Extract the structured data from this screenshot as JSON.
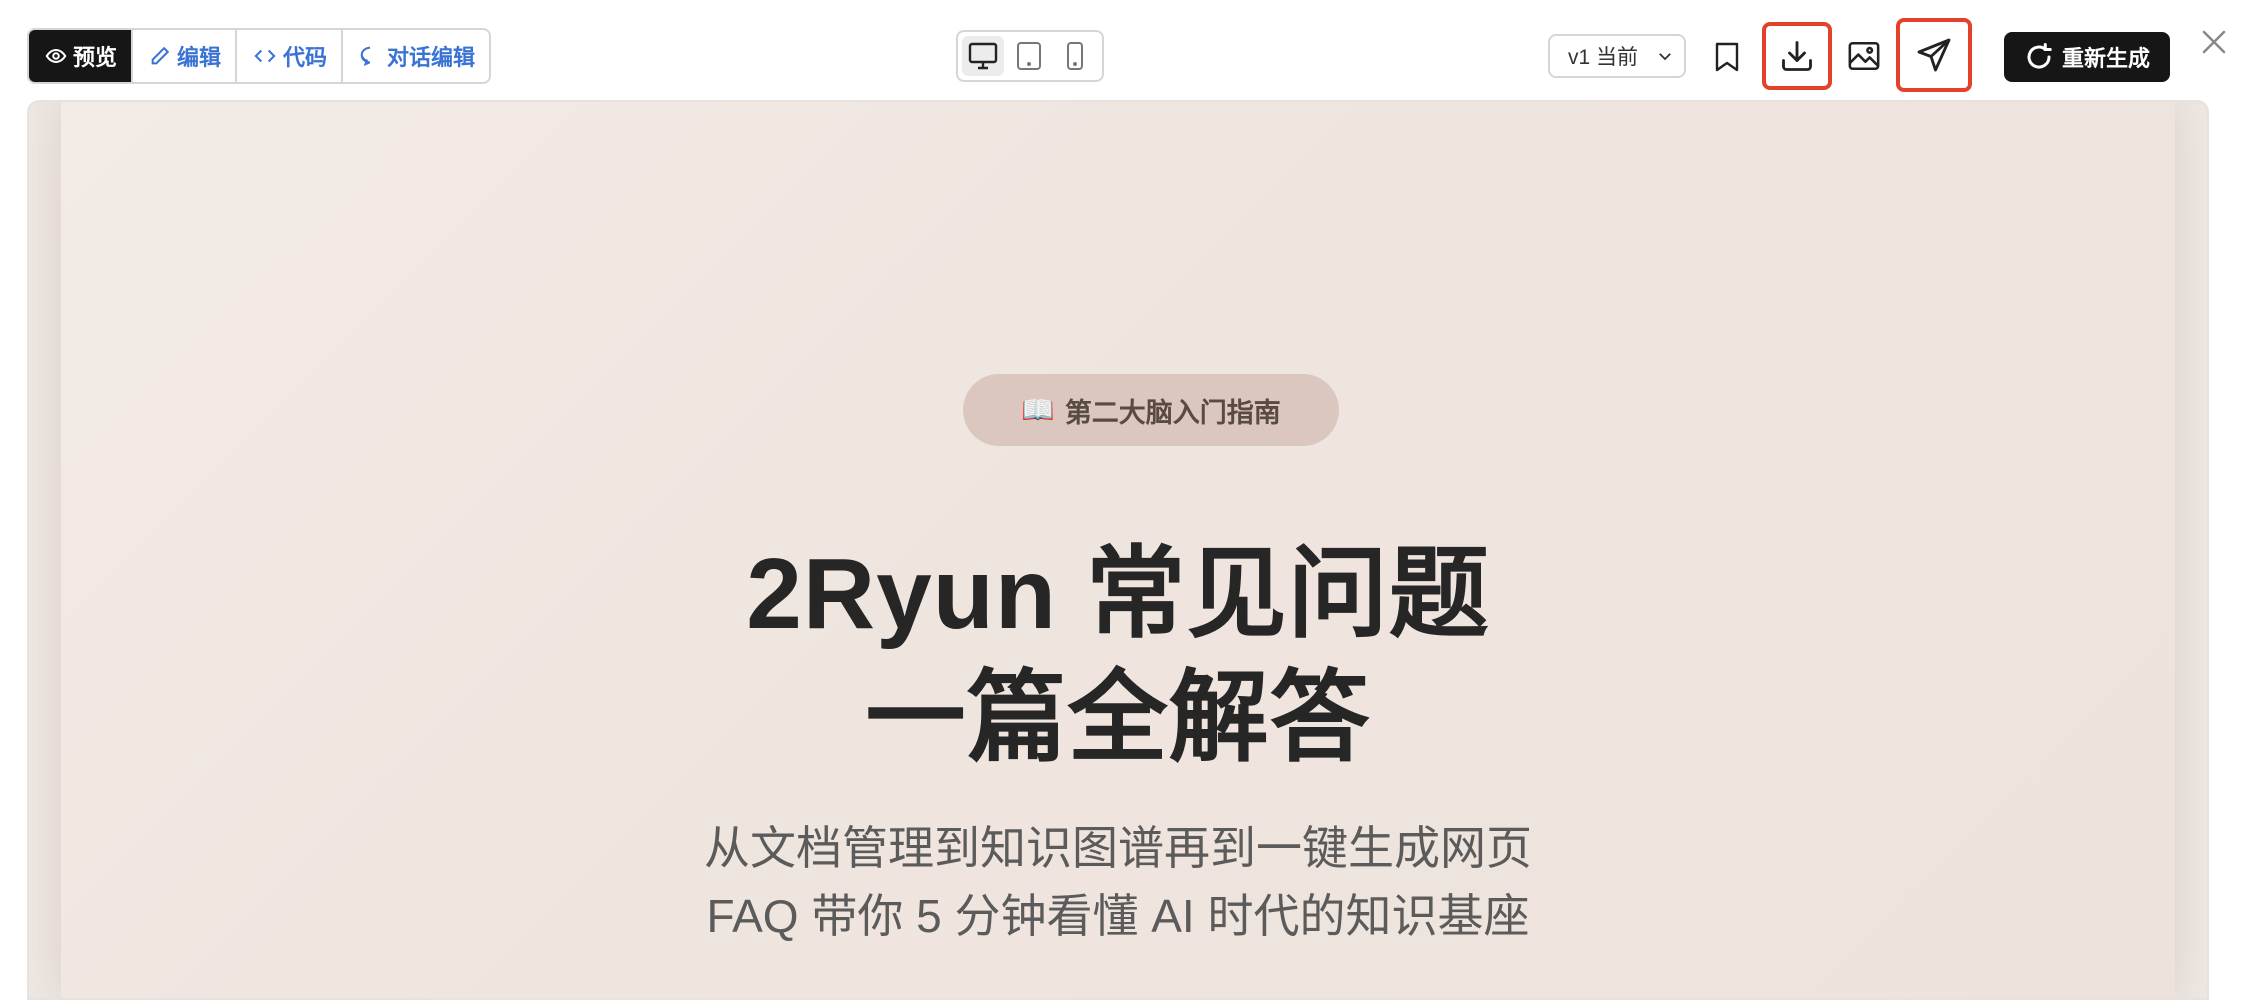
{
  "toolbar": {
    "modes": [
      {
        "label": "预览",
        "active": true
      },
      {
        "label": "编辑",
        "active": false
      },
      {
        "label": "代码",
        "active": false
      },
      {
        "label": "对话编辑",
        "active": false
      }
    ],
    "devices": [
      "desktop-icon",
      "tablet-icon",
      "mobile-icon"
    ],
    "version_label": "v1 当前",
    "regenerate_label": "重新生成",
    "highlight_color": "#e4412c"
  },
  "preview": {
    "badge_emoji": "📖",
    "badge_text": "第二大脑入门指南",
    "title_line1": "2Ryun 常见问题",
    "title_line2": "一篇全解答",
    "subtitle_line1": "从文档管理到知识图谱再到一键生成网页",
    "subtitle_line2": "FAQ 带你 5 分钟看懂 AI 时代的知识基座"
  }
}
